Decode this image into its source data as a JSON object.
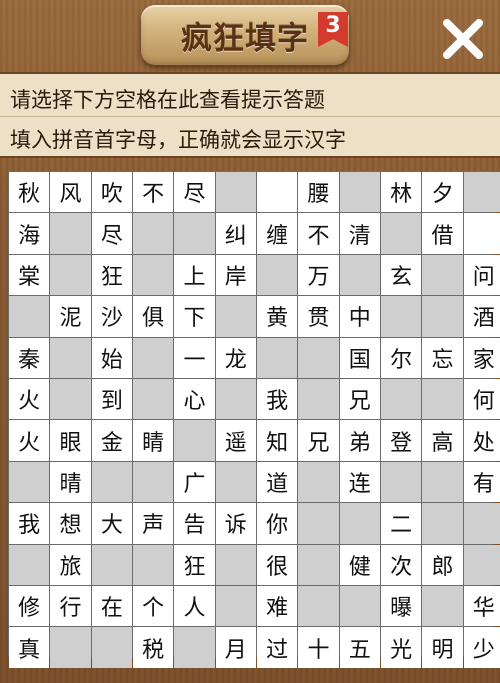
{
  "header": {
    "title": "疯狂填字",
    "level": "3"
  },
  "hint": {
    "line1": "请选择下方空格在此查看提示答题",
    "line2": "填入拼音首字母，正确就会显示汉字"
  },
  "grid": {
    "rows": [
      [
        "秋",
        "风",
        "吹",
        "不",
        "尽",
        "#",
        "",
        "腰",
        "#",
        "林",
        "夕",
        "#"
      ],
      [
        "海",
        "#",
        "尽",
        "#",
        "#",
        "纠",
        "缠",
        "不",
        "清",
        "#",
        "借",
        ""
      ],
      [
        "棠",
        "#",
        "狂",
        "#",
        "上",
        "岸",
        "#",
        "万",
        "#",
        "玄",
        "#",
        "问"
      ],
      [
        "#",
        "泥",
        "沙",
        "俱",
        "下",
        "#",
        "黄",
        "贯",
        "中",
        "#",
        "#",
        "酒"
      ],
      [
        "秦",
        "#",
        "始",
        "#",
        "一",
        "龙",
        "#",
        "#",
        "国",
        "尔",
        "忘",
        "家"
      ],
      [
        "火",
        "#",
        "到",
        "#",
        "心",
        "#",
        "我",
        "#",
        "兄",
        "#",
        "#",
        "何"
      ],
      [
        "火",
        "眼",
        "金",
        "睛",
        "#",
        "遥",
        "知",
        "兄",
        "弟",
        "登",
        "高",
        "处"
      ],
      [
        "#",
        "晴",
        "#",
        "#",
        "广",
        "#",
        "道",
        "#",
        "连",
        "#",
        "#",
        "有"
      ],
      [
        "我",
        "想",
        "大",
        "声",
        "告",
        "诉",
        "你",
        "#",
        "#",
        "二",
        "#",
        "#"
      ],
      [
        "#",
        "旅",
        "#",
        "#",
        "狂",
        "#",
        "很",
        "#",
        "健",
        "次",
        "郎",
        "#"
      ],
      [
        "修",
        "行",
        "在",
        "个",
        "人",
        "#",
        "难",
        "#",
        "#",
        "曝",
        "#",
        "华"
      ],
      [
        "真",
        "#",
        "#",
        "税",
        "#",
        "月",
        "过",
        "十",
        "五",
        "光",
        "明",
        "少"
      ]
    ]
  }
}
